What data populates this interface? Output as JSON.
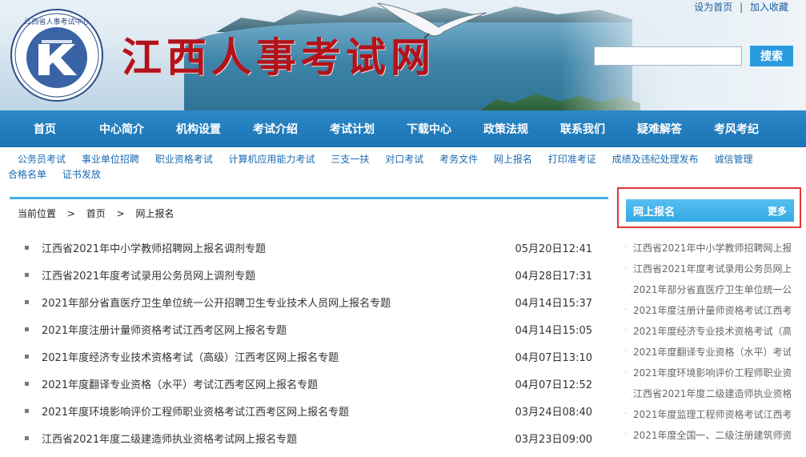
{
  "header": {
    "site_title": "江西人事考试网",
    "logo_caption": "江西省人事考试中心",
    "top_links": {
      "set_home": "设为首页",
      "separator": "|",
      "add_favorite": "加入收藏"
    },
    "search": {
      "placeholder": "",
      "button_label": "搜索"
    }
  },
  "nav": {
    "items": [
      "首页",
      "中心简介",
      "机构设置",
      "考试介绍",
      "考试计划",
      "下载中心",
      "政策法规",
      "联系我们",
      "疑难解答",
      "考风考纪"
    ]
  },
  "subnav": {
    "items": [
      "公务员考试",
      "事业单位招聘",
      "职业资格考试",
      "计算机应用能力考试",
      "三支一扶",
      "对口考试",
      "考务文件",
      "网上报名",
      "打印准考证",
      "成绩及违纪处理发布",
      "诚信管理",
      "合格名单",
      "证书发放"
    ]
  },
  "breadcrumb": {
    "prefix": "当前位置",
    "sep": ">",
    "items": [
      "首页",
      "网上报名"
    ]
  },
  "list": {
    "items": [
      {
        "title": "江西省2021年中小学教师招聘网上报名调剂专题",
        "date": "05月20日12:41"
      },
      {
        "title": "江西省2021年度考试录用公务员网上调剂专题",
        "date": "04月28日17:31"
      },
      {
        "title": "2021年部分省直医疗卫生单位统一公开招聘卫生专业技术人员网上报名专题",
        "date": "04月14日15:37"
      },
      {
        "title": "2021年度注册计量师资格考试江西考区网上报名专题",
        "date": "04月14日15:05"
      },
      {
        "title": "2021年度经济专业技术资格考试（高级）江西考区网上报名专题",
        "date": "04月07日13:10"
      },
      {
        "title": "2021年度翻译专业资格（水平）考试江西考区网上报名专题",
        "date": "04月07日12:52"
      },
      {
        "title": "2021年度环境影响评价工程师职业资格考试江西考区网上报名专题",
        "date": "03月24日08:40"
      },
      {
        "title": "江西省2021年度二级建造师执业资格考试网上报名专题",
        "date": "03月23日09:00"
      }
    ]
  },
  "sidebar": {
    "title": "网上报名",
    "more": "更多",
    "items": [
      "江西省2021年中小学教师招聘网上报",
      "江西省2021年度考试录用公务员网上",
      "2021年部分省直医疗卫生单位统一公",
      "2021年度注册计量师资格考试江西考",
      "2021年度经济专业技术资格考试（高",
      "2021年度翻译专业资格（水平）考试",
      "2021年度环境影响评价工程师职业资",
      "江西省2021年度二级建造师执业资格",
      "2021年度监理工程师资格考试江西考",
      "2021年度全国一、二级注册建筑师资"
    ]
  },
  "colors": {
    "nav_bg": "#1b73b4",
    "title_red": "#b3121a",
    "accent_blue": "#34a9e4",
    "highlight_border": "#e33737",
    "link_blue": "#1a6ab0"
  }
}
